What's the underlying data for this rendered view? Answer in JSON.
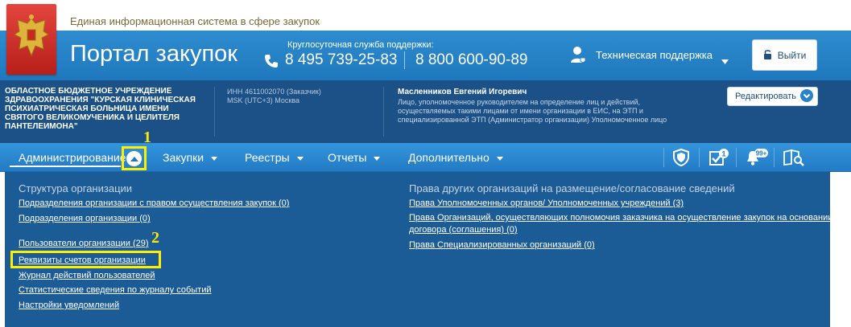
{
  "top": {
    "system_name": "Единая информационная система в сфере закупок"
  },
  "header": {
    "portal_title": "Портал закупок",
    "support_caption": "Круглосуточная служба поддержки:",
    "phone_1": "8 495 739-25-83",
    "phone_2": "8 800 600-90-89",
    "tech_support": "Техническая поддержка",
    "logout": "Выйти"
  },
  "org": {
    "name": "ОБЛАСТНОЕ БЮДЖЕТНОЕ УЧРЕЖДЕНИЕ ЗДРАВООХРАНЕНИЯ \"КУРСКАЯ КЛИНИЧЕСКАЯ ПСИХИАТРИЧЕСКАЯ БОЛЬНИЦА ИМЕНИ СВЯТОГО ВЕЛИКОМУЧЕНИКА И ЦЕЛИТЕЛЯ ПАНТЕЛЕИМОНА\"",
    "inn": "ИНН 4611002070 (Заказчик)",
    "timezone": "MSK (UTC+3) Москва",
    "person": "Масленников Евгений Игоревич",
    "role": "Лицо, уполномоченное руководителем на определение лиц и действий, осуществляемых такими лицами от имени организации в ЕИС, на ЭТП и специализированной ЭТП (Администратор организации) Уполномоченное лицо",
    "edit_button": "Редактировать"
  },
  "nav": {
    "items": [
      "Администрирование",
      "Закупки",
      "Реестры",
      "Отчеты",
      "Дополнительно"
    ],
    "badges": {
      "tasks": "1",
      "notifications": "99+"
    }
  },
  "markers": {
    "first": "1",
    "second": "2"
  },
  "menu": {
    "left_title": "Структура организации",
    "left_links": [
      "Подразделения организации с правом осуществления закупок (0)",
      "Подразделения организации (0)",
      "Пользователи организации (29)",
      "Реквизиты счетов организации",
      "Журнал действий пользователей",
      "Статистические сведения по журналу событий",
      "Настройки уведомлений"
    ],
    "right_title": "Права других организаций на размещение/согласование сведений",
    "right_links": [
      "Права Уполномоченных органов/ Уполномоченных учреждений (3)",
      "Права Организаций, осуществляющих полномочия заказчика на осуществление закупок на основании договора (соглашения) (0)",
      "Права Специализированных организаций (0)"
    ]
  },
  "colors": {
    "header_blue": "#2784cb",
    "org_bar": "#1b5186",
    "menu_panel": "#1b5b96",
    "highlight": "#ffee00"
  }
}
